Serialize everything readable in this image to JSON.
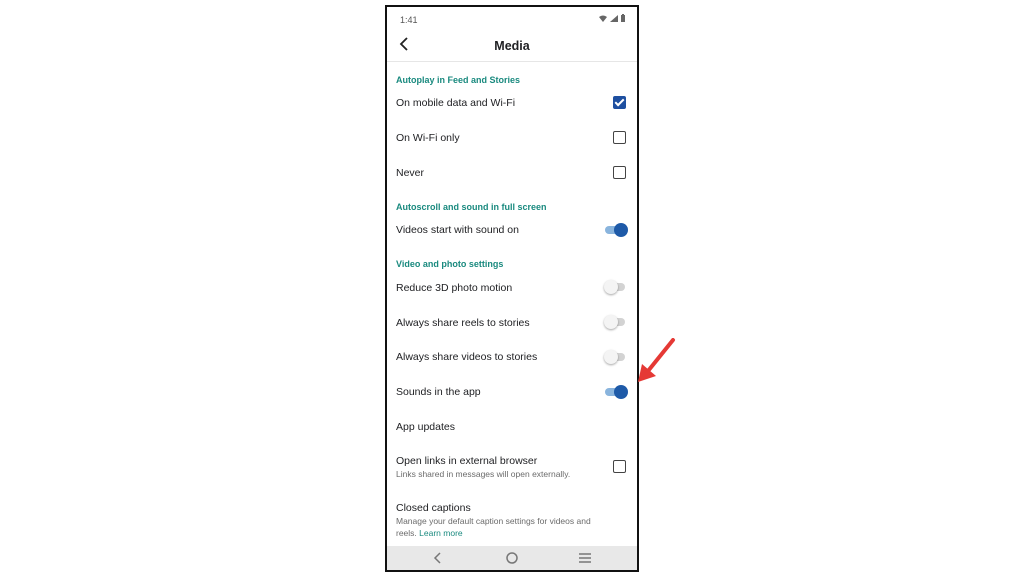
{
  "status_bar": {
    "time": "1:41",
    "icons": "wifi-icon signal-icon battery-icon"
  },
  "header": {
    "title": "Media",
    "back_icon": "chevron-left-icon"
  },
  "sections": {
    "autoplay": "Autoplay in Feed and Stories",
    "autoscroll": "Autoscroll and sound in full screen",
    "video_photo": "Video and photo settings"
  },
  "autoplay_options": [
    {
      "label": "On mobile data and Wi-Fi",
      "checked": true
    },
    {
      "label": "On Wi-Fi only",
      "checked": false
    },
    {
      "label": "Never",
      "checked": false
    }
  ],
  "autoscroll_settings": [
    {
      "label": "Videos start with sound on",
      "on": true
    }
  ],
  "video_photo_settings": [
    {
      "label": "Reduce 3D photo motion",
      "on": false
    },
    {
      "label": "Always share reels to stories",
      "on": false
    },
    {
      "label": "Always share videos to stories",
      "on": false
    },
    {
      "label": "Sounds in the app",
      "on": true
    }
  ],
  "app_updates": {
    "label": "App updates"
  },
  "external_browser": {
    "label": "Open links in external browser",
    "description": "Links shared in messages will open externally.",
    "checked": false
  },
  "closed_captions": {
    "label": "Closed captions",
    "description_line1": "Manage your default caption settings for videos and",
    "description_line2": "reels.",
    "link": "Learn more"
  },
  "nav_bar": {
    "back_icon": "nav-back-icon",
    "home_icon": "nav-home-icon",
    "menu_icon": "nav-menu-icon"
  },
  "colors": {
    "accent_teal": "#1a8a7f",
    "toggle_on": "#1e5aa8",
    "checkbox_on": "#1e4fa0",
    "arrow": "#e53935"
  }
}
